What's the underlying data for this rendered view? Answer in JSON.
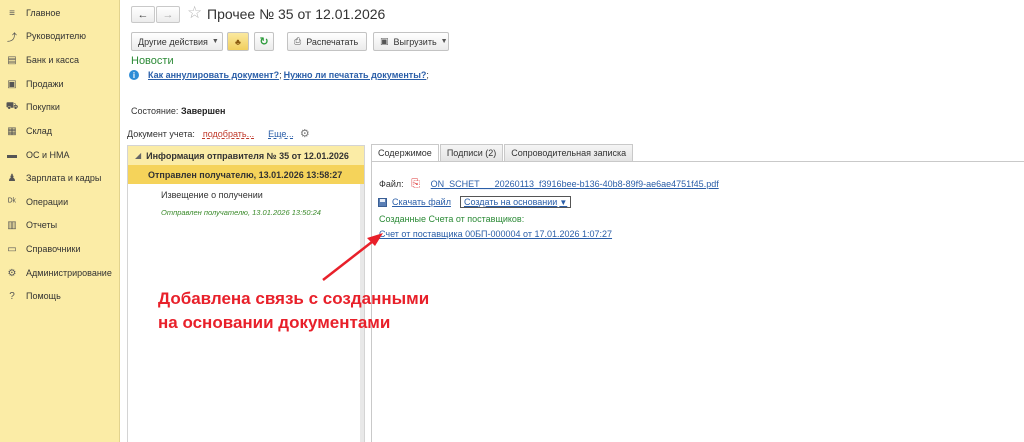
{
  "sidebar": {
    "items": [
      {
        "label": "Главное",
        "icon": "menu-icon"
      },
      {
        "label": "Руководителю",
        "icon": "trend-icon"
      },
      {
        "label": "Банк и касса",
        "icon": "bank-icon"
      },
      {
        "label": "Продажи",
        "icon": "sales-icon"
      },
      {
        "label": "Покупки",
        "icon": "cart-icon"
      },
      {
        "label": "Склад",
        "icon": "warehouse-icon"
      },
      {
        "label": "ОС и НМА",
        "icon": "assets-icon"
      },
      {
        "label": "Зарплата и кадры",
        "icon": "people-icon"
      },
      {
        "label": "Операции",
        "icon": "operations-icon"
      },
      {
        "label": "Отчеты",
        "icon": "reports-icon"
      },
      {
        "label": "Справочники",
        "icon": "book-icon"
      },
      {
        "label": "Администрирование",
        "icon": "gear-icon"
      },
      {
        "label": "Помощь",
        "icon": "help-icon"
      }
    ]
  },
  "header": {
    "back": "←",
    "forward": "→",
    "star": "☆",
    "title": "Прочее № 35 от 12.01.2026"
  },
  "toolbar": {
    "other_actions": "Другие действия",
    "print": "Распечатать",
    "export": "Выгрузить"
  },
  "news": {
    "label": "Новости",
    "link1": "Как аннулировать документ?",
    "sep": ";",
    "link2": "Нужно ли печатать документы?",
    "end": ";"
  },
  "state": {
    "label": "Состояние:",
    "value": "Завершен"
  },
  "accounting": {
    "label": "Документ учета:",
    "pick": "подобрать...",
    "more": "Еще..."
  },
  "left_panel": {
    "header": "Информация отправителя № 35 от 12.01.2026",
    "selected": "Отправлен получателю, 13.01.2026 13:58:27",
    "notice": "Извещение о получении",
    "notice_status": "Отправлен получателю, 13.01.2026 13:50:24"
  },
  "tabs": [
    {
      "label": "Содержимое",
      "active": true
    },
    {
      "label": "Подписи (2)",
      "active": false
    },
    {
      "label": "Сопроводительная записка",
      "active": false
    }
  ],
  "content": {
    "file_label": "Файл:",
    "file_name": "ON_SCHET___20260113_f3916bee-b136-40b8-89f9-ae6ae4751f45.pdf",
    "download": "Скачать файл",
    "create_based": "Создать на основании",
    "create_caret": "▼",
    "created_label": "Созданные Счета от поставщиков:",
    "created_link": "Счет от поставщика 00БП-000004 от 17.01.2026 1:07:27"
  },
  "annotation": {
    "line1": "Добавлена связь с созданными",
    "line2": "на основании документами",
    "color": "#e8202a"
  }
}
